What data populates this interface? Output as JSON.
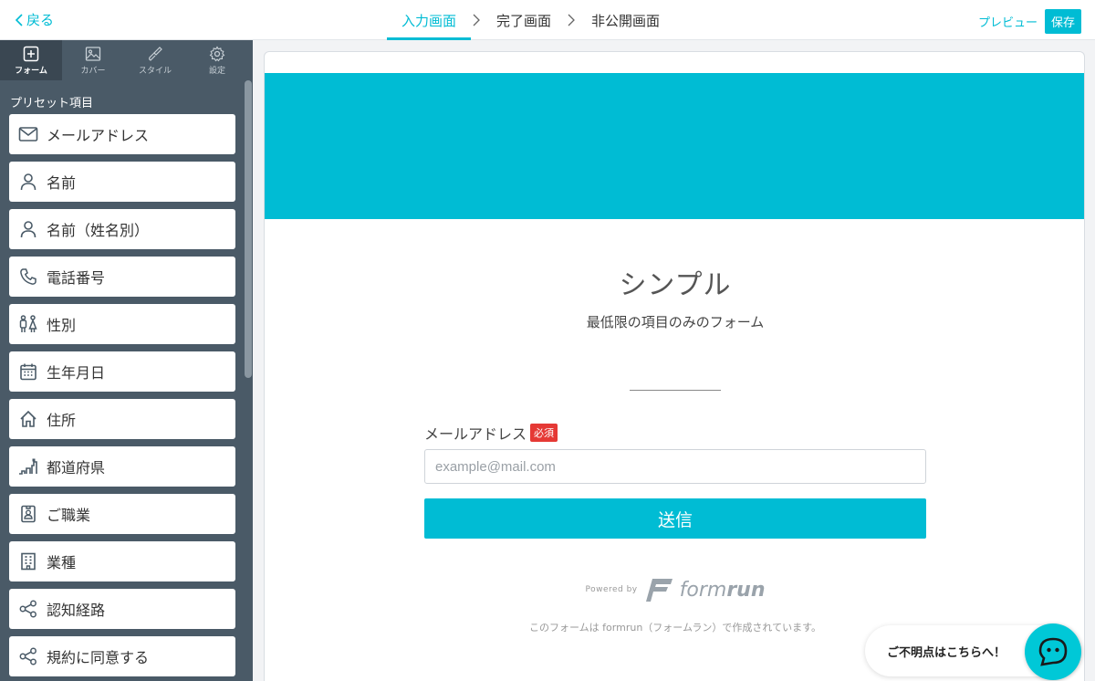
{
  "header": {
    "back_label": "戻る",
    "steps": [
      {
        "label": "入力画面",
        "active": true
      },
      {
        "label": "完了画面",
        "active": false
      },
      {
        "label": "非公開画面",
        "active": false
      }
    ],
    "preview_label": "プレビュー",
    "save_label": "保存",
    "accent_color": "#00bcd4"
  },
  "sidebar": {
    "tabs": [
      {
        "label": "フォーム",
        "icon": "plus-square-icon",
        "active": true
      },
      {
        "label": "カバー",
        "icon": "image-icon",
        "active": false
      },
      {
        "label": "スタイル",
        "icon": "brush-icon",
        "active": false
      },
      {
        "label": "設定",
        "icon": "gear-icon",
        "active": false
      }
    ],
    "section_title": "プリセット項目",
    "items": [
      {
        "label": "メールアドレス",
        "icon": "mail-icon"
      },
      {
        "label": "名前",
        "icon": "person-icon"
      },
      {
        "label": "名前（姓名別）",
        "icon": "person-icon"
      },
      {
        "label": "電話番号",
        "icon": "phone-icon"
      },
      {
        "label": "性別",
        "icon": "gender-icon"
      },
      {
        "label": "生年月日",
        "icon": "calendar-icon"
      },
      {
        "label": "住所",
        "icon": "home-icon"
      },
      {
        "label": "都道府県",
        "icon": "prefecture-icon"
      },
      {
        "label": "ご職業",
        "icon": "id-badge-icon"
      },
      {
        "label": "業種",
        "icon": "building-icon"
      },
      {
        "label": "認知経路",
        "icon": "share-icon"
      },
      {
        "label": "規約に同意する",
        "icon": "share-icon"
      }
    ]
  },
  "form": {
    "cover_color": "#00bcd4",
    "title": "シンプル",
    "description": "最低限の項目のみのフォーム",
    "field_label": "メールアドレス",
    "required_badge": "必須",
    "email_placeholder": "example@mail.com",
    "email_value": "",
    "submit_label": "送信",
    "powered_by": "Powered by",
    "logo_text_light": "form",
    "logo_text_bold": "run",
    "footer_note": "このフォームは formrun（フォームラン）で作成されています。"
  },
  "help": {
    "label": "ご不明点はこちらへ！",
    "icon": "chat-icon"
  }
}
